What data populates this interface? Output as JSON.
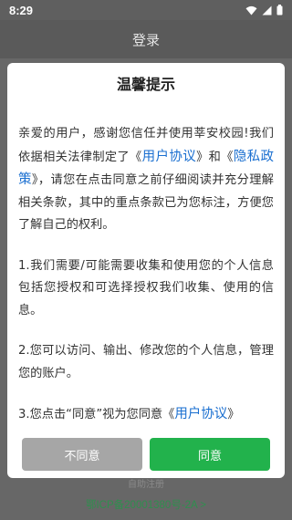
{
  "status": {
    "time": "8:29"
  },
  "header": {
    "title": "登录"
  },
  "footer": {
    "self_register": "自助注册",
    "icp": "鄂ICP备20001380号-2A >"
  },
  "dialog": {
    "title": "温馨提示",
    "p1_a": "亲爱的用户，感谢您信任并使用莘安校园!我们依据相关法律制定了《",
    "link_user": "用户协议",
    "p1_b": "》和《",
    "link_privacy": "隐私政策",
    "p1_c": "》，请您在点击同意之前仔细阅读并充分理解相关条款，其中的重点条款已为您标注，方便您了解自己的权利。",
    "p2": "1.我们需要/可能需要收集和使用您的个人信息包括您授权和可选择授权我们收集、使用的信息。",
    "p3": "2.您可以访问、输出、修改您的个人信息，管理您的账户。",
    "p4_a": "3.您点击“同意”视为您同意《",
    "p4_link": "用户协议",
    "p4_b": "》",
    "disagree": "不同意",
    "agree": "同意"
  },
  "colors": {
    "accent": "#22b24c",
    "link": "#1a6fd0",
    "disabled": "#a6a6a6"
  }
}
